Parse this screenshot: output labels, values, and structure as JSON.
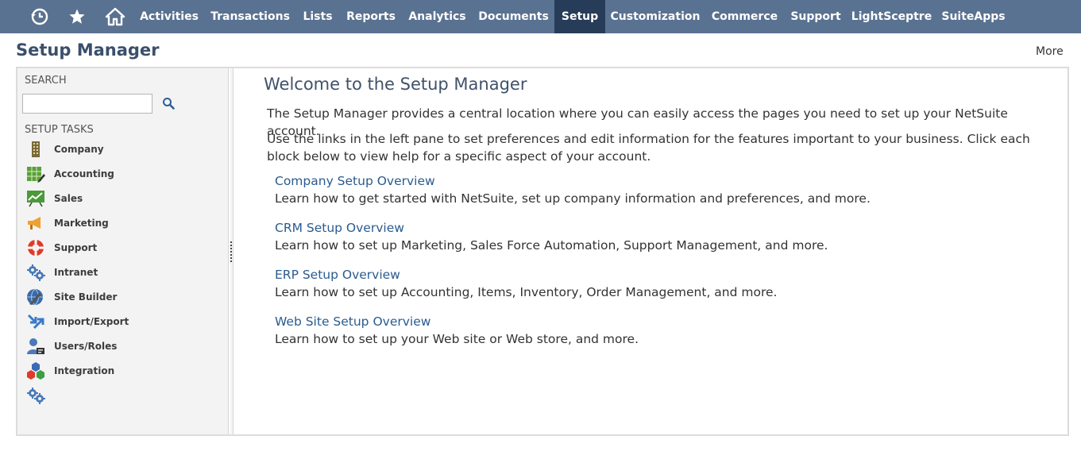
{
  "nav": {
    "items": [
      {
        "label": "Activities"
      },
      {
        "label": "Transactions"
      },
      {
        "label": "Lists"
      },
      {
        "label": "Reports"
      },
      {
        "label": "Analytics"
      },
      {
        "label": "Documents"
      },
      {
        "label": "Setup",
        "active": true
      },
      {
        "label": "Customization"
      },
      {
        "label": "Commerce"
      },
      {
        "label": "Support"
      },
      {
        "label": "LightSceptre"
      },
      {
        "label": "SuiteApps"
      }
    ],
    "icons": [
      "recent-history-icon",
      "star-icon",
      "home-icon"
    ],
    "bar_color": "#5a7291",
    "active_color": "#263c58"
  },
  "page": {
    "title": "Setup Manager",
    "more_label": "More"
  },
  "left_pane": {
    "search_label": "SEARCH",
    "search_value": "",
    "tasks_label": "SETUP TASKS",
    "tasks": [
      {
        "label": "Company",
        "icon": "building-icon"
      },
      {
        "label": "Accounting",
        "icon": "ledger-icon"
      },
      {
        "label": "Sales",
        "icon": "sales-chart-icon"
      },
      {
        "label": "Marketing",
        "icon": "megaphone-icon"
      },
      {
        "label": "Support",
        "icon": "lifebuoy-icon"
      },
      {
        "label": "Intranet",
        "icon": "gears-icon"
      },
      {
        "label": "Site Builder",
        "icon": "globe-tools-icon"
      },
      {
        "label": "Import/Export",
        "icon": "import-export-arrows-icon"
      },
      {
        "label": "Users/Roles",
        "icon": "users-roles-icon"
      },
      {
        "label": "Integration",
        "icon": "integration-cubes-icon"
      },
      {
        "label": "",
        "icon": "gears-icon"
      }
    ]
  },
  "content": {
    "welcome": "Welcome to the Setup Manager",
    "intro1": "The Setup Manager provides a central location where you can easily access the pages you need to set up your NetSuite account.",
    "intro2": "Use the links in the left pane to set preferences and edit information for the features important to your business. Click each block below to view help for a specific aspect of your account.",
    "overviews": [
      {
        "title": "Company Setup Overview",
        "desc": "Learn how to get started with NetSuite, set up company information and preferences, and more."
      },
      {
        "title": "CRM Setup Overview",
        "desc": "Learn how to set up Marketing, Sales Force Automation, Support Management, and more."
      },
      {
        "title": "ERP Setup Overview",
        "desc": "Learn how to set up Accounting, Items, Inventory, Order Management, and more."
      },
      {
        "title": "Web Site Setup Overview",
        "desc": "Learn how to set up your Web site or Web store, and more."
      }
    ]
  }
}
